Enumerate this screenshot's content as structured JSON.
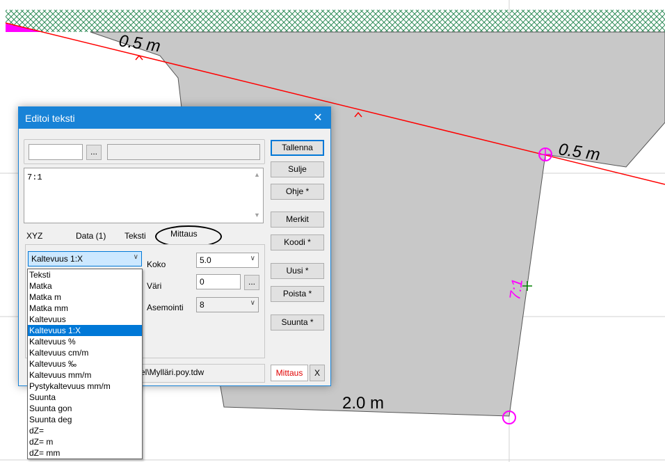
{
  "drawing": {
    "labels": {
      "top_left_distance": "0.5 m",
      "right_distance": "0.5 m",
      "bottom_distance": "2.0 m",
      "slope_label": "7:1"
    },
    "colors": {
      "polygon_fill": "#c8c8c8",
      "line_red": "#ff0000",
      "marker_magenta": "#ff00ff",
      "hatch_green": "#2e8b57",
      "cross_green": "#008000"
    }
  },
  "dialog": {
    "title": "Editoi teksti",
    "close_glyph": "✕",
    "browse_label": "...",
    "field1_value": "",
    "field2_value": "",
    "text_content": "7:1",
    "tabs": [
      "XYZ",
      "Data (1)",
      "Teksti",
      "Mittaus"
    ],
    "active_tab": "Mittaus",
    "type_combo_value": "Kaltevuus 1:X",
    "size_label": "Koko",
    "size_value": "5.0",
    "color_label": "Väri",
    "color_value": "0",
    "color_button_label": "...",
    "placement_label": "Asemointi",
    "placement_value": "8",
    "path_text": "el\\Mylläri.poy.tdw",
    "mode_button": "Mittaus",
    "x_button": "X",
    "buttons": {
      "save": "Tallenna",
      "close": "Sulje",
      "help": "Ohje *",
      "marks": "Merkit",
      "code": "Koodi *",
      "new": "Uusi *",
      "delete": "Poista *",
      "direction": "Suunta *"
    }
  },
  "dropdown": {
    "items": [
      "Teksti",
      "Matka",
      "Matka m",
      "Matka mm",
      "Kaltevuus",
      "Kaltevuus 1:X",
      "Kaltevuus %",
      "Kaltevuus cm/m",
      "Kaltevuus ‰",
      "Kaltevuus mm/m",
      "Pystykaltevuus mm/m",
      "Suunta",
      "Suunta gon",
      "Suunta deg",
      "dZ=",
      "dZ= m",
      "dZ= mm"
    ],
    "selected": "Kaltevuus 1:X"
  }
}
